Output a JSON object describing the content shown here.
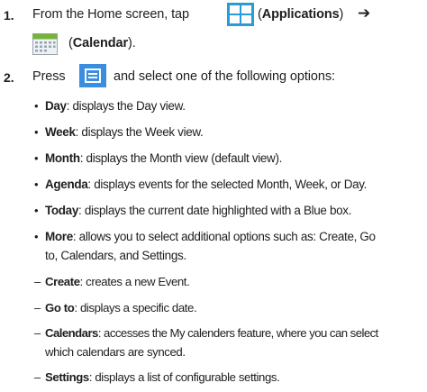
{
  "steps": [
    {
      "number": "1.",
      "line1_pre": "From the Home screen, tap",
      "line1_paren_open": "(",
      "line1_bold": "Applications",
      "line1_paren_close": ")",
      "arrow": "➔",
      "line2_paren_open": "(",
      "line2_bold": "Calendar",
      "line2_end": ").",
      "icons": [
        "applications-icon",
        "calendar-icon"
      ],
      "colors": {
        "applications": "#2a9bd6",
        "calendar_header": "#74b43c"
      }
    },
    {
      "number": "2.",
      "pre": "Press",
      "post": "and select one of the following options:",
      "icons": [
        "menu-key-icon"
      ],
      "colors": {
        "menu_key": "#3a8ee0"
      }
    }
  ],
  "options": [
    {
      "bullet": "•",
      "term": "Day",
      "text": ": displays the Day view."
    },
    {
      "bullet": "•",
      "term": "Week",
      "text": ": displays the Week view."
    },
    {
      "bullet": "•",
      "term": "Month",
      "text": ": displays the Month view (default view)."
    },
    {
      "bullet": "•",
      "term": "Agenda",
      "text": ": displays events for the selected Month, Week, or Day."
    },
    {
      "bullet": "•",
      "term": "Today",
      "text": ": displays the current date highlighted with a Blue box."
    },
    {
      "bullet": "•",
      "term": "More",
      "text": ": allows you to select additional options such as: Create, Go",
      "cont": "to, Calendars, and Settings."
    }
  ],
  "sub_options": [
    {
      "dash": "–",
      "term": "Create",
      "text": ": creates a new Event."
    },
    {
      "dash": "–",
      "term": "Go to",
      "text": ": displays a specific date."
    },
    {
      "dash": "–",
      "term": "Calendars",
      "text": ": accesses the My calenders feature, where you can select",
      "cont": "which calendars are synced."
    },
    {
      "dash": "–",
      "term": "Settings",
      "text": ": displays a list of configurable settings."
    }
  ]
}
